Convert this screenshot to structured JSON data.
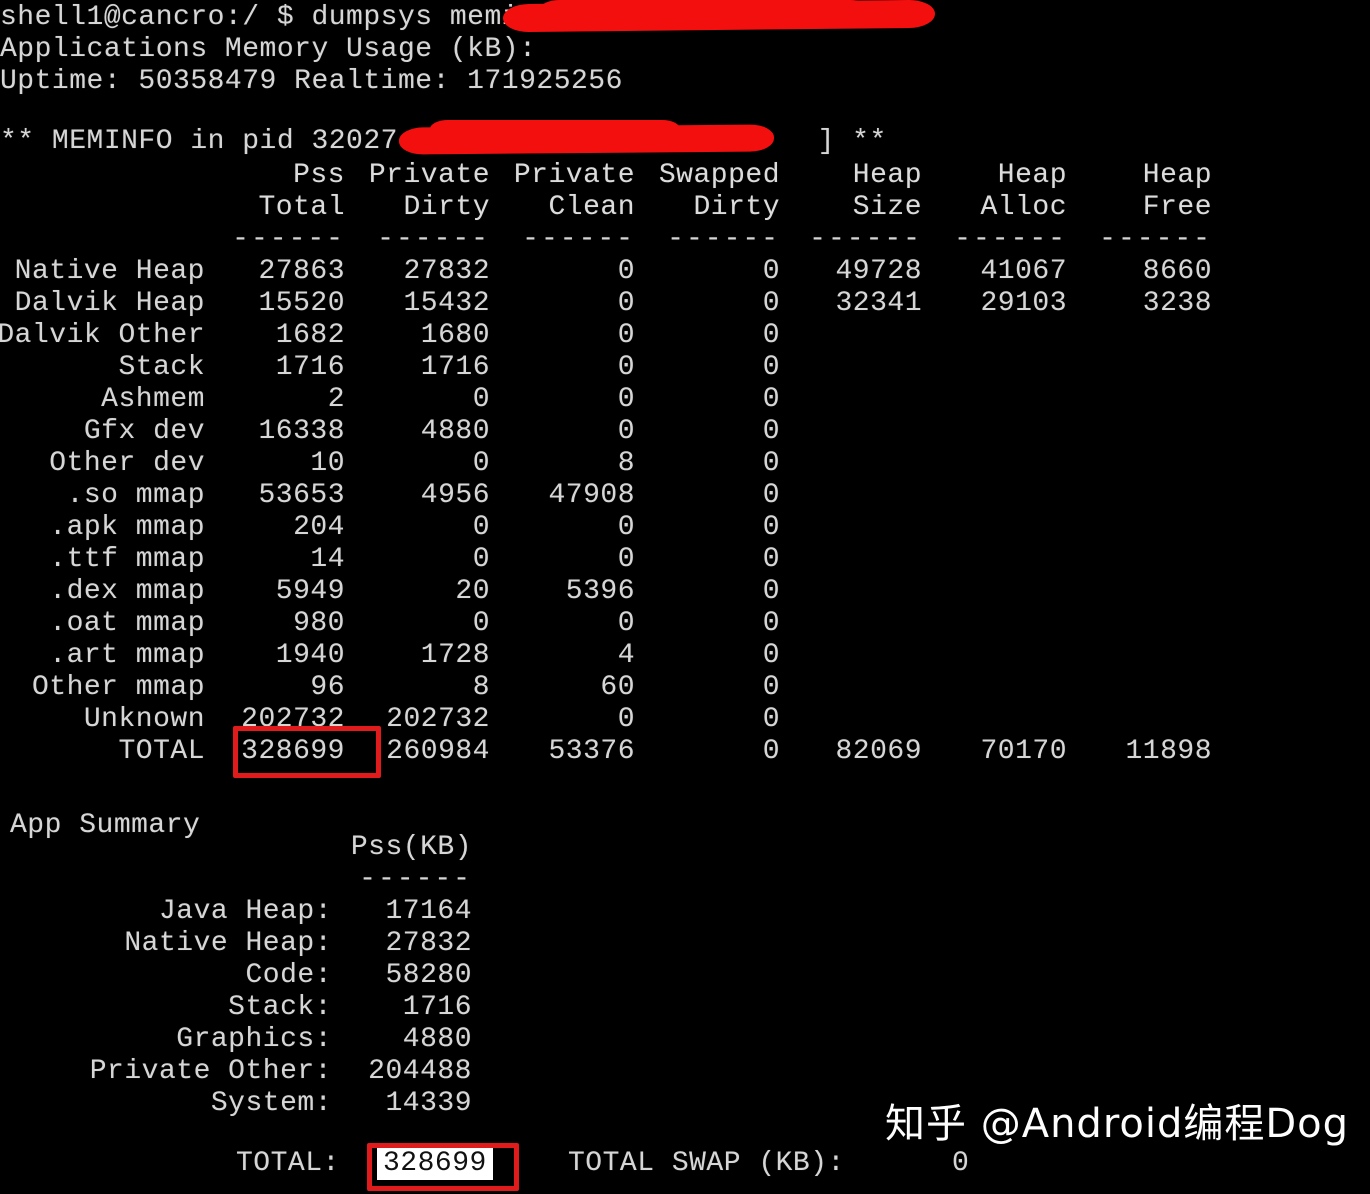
{
  "terminal": {
    "prompt_line": "shell1@cancro:/ $ dumpsys meminfo",
    "title_line": "Applications Memory Usage (kB):",
    "uptime_line": "Uptime: 50358479 Realtime: 171925256",
    "meminfo_header_prefix": "** MEMINFO in pid 32027 [",
    "meminfo_header_suffix": "] **"
  },
  "table": {
    "headers_top": [
      "Pss",
      "Private",
      "Private",
      "Swapped",
      "Heap",
      "Heap",
      "Heap"
    ],
    "headers_bottom": [
      "Total",
      "Dirty",
      "Clean",
      "Dirty",
      "Size",
      "Alloc",
      "Free"
    ],
    "rule": "------",
    "rows": [
      {
        "label": "Native Heap",
        "values": [
          "27863",
          "27832",
          "0",
          "0",
          "49728",
          "41067",
          "8660"
        ]
      },
      {
        "label": "Dalvik Heap",
        "values": [
          "15520",
          "15432",
          "0",
          "0",
          "32341",
          "29103",
          "3238"
        ]
      },
      {
        "label": "Dalvik Other",
        "values": [
          "1682",
          "1680",
          "0",
          "0",
          "",
          "",
          ""
        ]
      },
      {
        "label": "Stack",
        "values": [
          "1716",
          "1716",
          "0",
          "0",
          "",
          "",
          ""
        ]
      },
      {
        "label": "Ashmem",
        "values": [
          "2",
          "0",
          "0",
          "0",
          "",
          "",
          ""
        ]
      },
      {
        "label": "Gfx dev",
        "values": [
          "16338",
          "4880",
          "0",
          "0",
          "",
          "",
          ""
        ]
      },
      {
        "label": "Other dev",
        "values": [
          "10",
          "0",
          "8",
          "0",
          "",
          "",
          ""
        ]
      },
      {
        "label": ".so mmap",
        "values": [
          "53653",
          "4956",
          "47908",
          "0",
          "",
          "",
          ""
        ]
      },
      {
        "label": ".apk mmap",
        "values": [
          "204",
          "0",
          "0",
          "0",
          "",
          "",
          ""
        ]
      },
      {
        "label": ".ttf mmap",
        "values": [
          "14",
          "0",
          "0",
          "0",
          "",
          "",
          ""
        ]
      },
      {
        "label": ".dex mmap",
        "values": [
          "5949",
          "20",
          "5396",
          "0",
          "",
          "",
          ""
        ]
      },
      {
        "label": ".oat mmap",
        "values": [
          "980",
          "0",
          "0",
          "0",
          "",
          "",
          ""
        ]
      },
      {
        "label": ".art mmap",
        "values": [
          "1940",
          "1728",
          "4",
          "0",
          "",
          "",
          ""
        ]
      },
      {
        "label": "Other mmap",
        "values": [
          "96",
          "8",
          "60",
          "0",
          "",
          "",
          ""
        ]
      },
      {
        "label": "Unknown",
        "values": [
          "202732",
          "202732",
          "0",
          "0",
          "",
          "",
          ""
        ]
      },
      {
        "label": "TOTAL",
        "values": [
          "328699",
          "260984",
          "53376",
          "0",
          "82069",
          "70170",
          "11898"
        ]
      }
    ]
  },
  "app_summary": {
    "section_title": "App Summary",
    "column_header": "Pss(KB)",
    "rule": "------",
    "rows": [
      {
        "label": "Java Heap:",
        "value": "17164"
      },
      {
        "label": "Native Heap:",
        "value": "27832"
      },
      {
        "label": "Code:",
        "value": "58280"
      },
      {
        "label": "Stack:",
        "value": "1716"
      },
      {
        "label": "Graphics:",
        "value": "4880"
      },
      {
        "label": "Private Other:",
        "value": "204488"
      },
      {
        "label": "System:",
        "value": "14339"
      }
    ],
    "footer": {
      "total_label": "TOTAL:",
      "total_value": "328699",
      "swap_label": "TOTAL SWAP (KB):",
      "swap_value": "0"
    }
  },
  "annotations": {
    "highlight_color": "#e01b1b",
    "redaction_color": "#f40f0f",
    "selection_bg": "#ffffff",
    "selection_fg": "#111111",
    "terminal_bg": "#000000",
    "terminal_fg": "#d6d6d6"
  },
  "watermark": {
    "text": "知乎 @Android编程Dog"
  }
}
